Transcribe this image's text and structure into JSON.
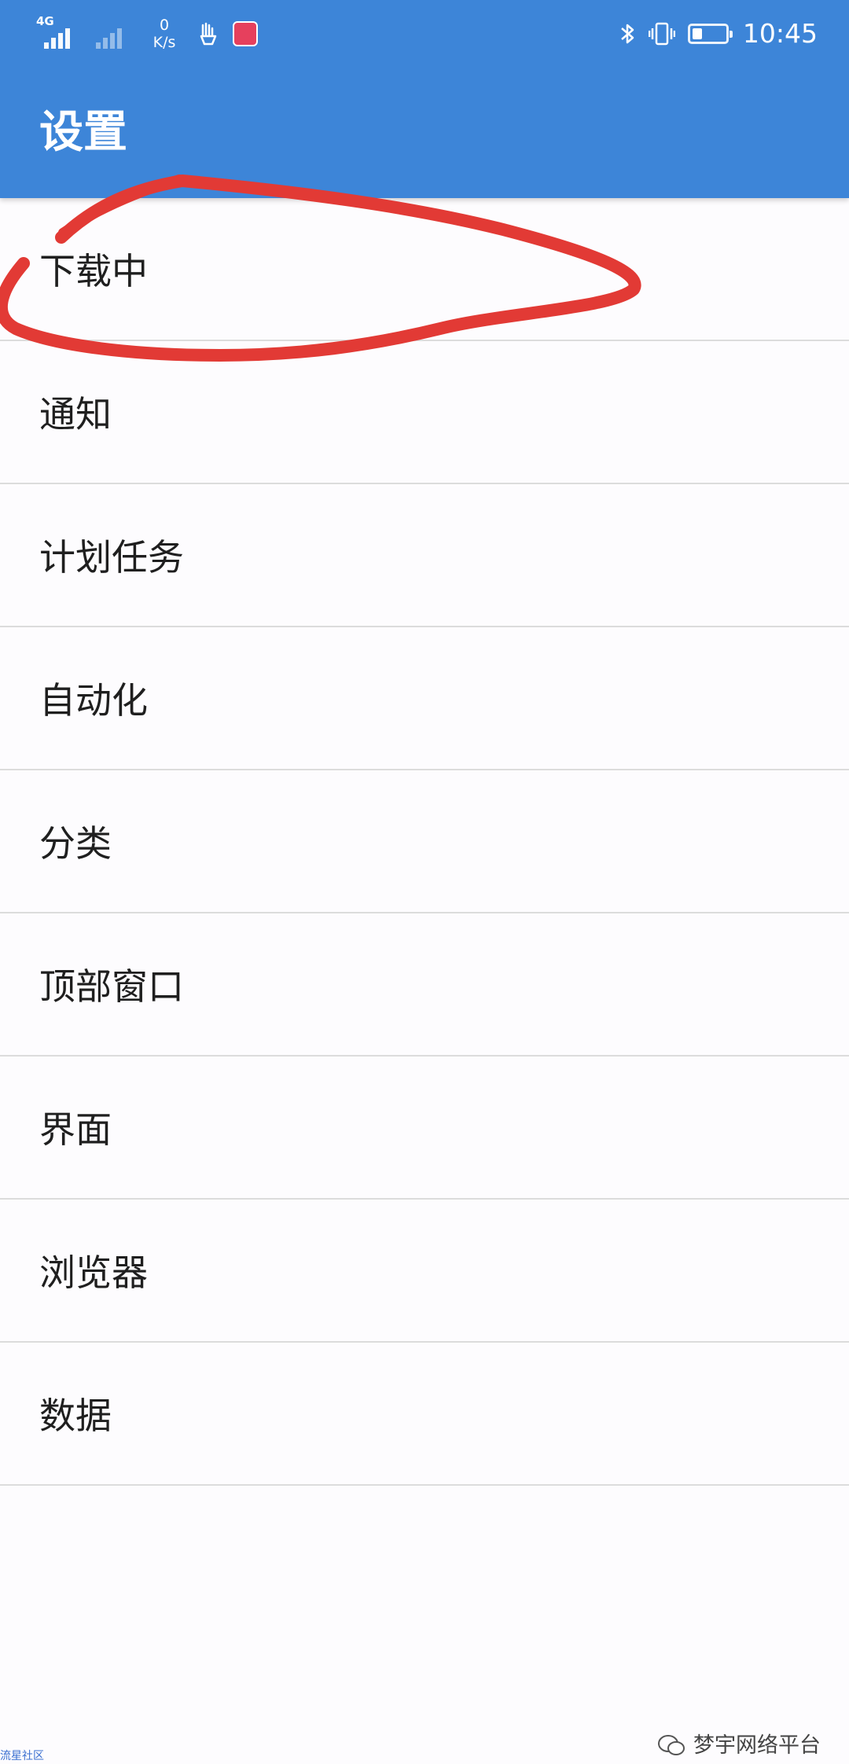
{
  "status_bar": {
    "network_type": "4G",
    "net_speed_value": "0",
    "net_speed_unit": "K/s",
    "time": "10:45",
    "battery_level_percent": 30
  },
  "app_bar": {
    "title": "设置"
  },
  "settings_items": [
    {
      "label": "下载中"
    },
    {
      "label": "通知"
    },
    {
      "label": "计划任务"
    },
    {
      "label": "自动化"
    },
    {
      "label": "分类"
    },
    {
      "label": "顶部窗口"
    },
    {
      "label": "界面"
    },
    {
      "label": "浏览器"
    },
    {
      "label": "数据"
    }
  ],
  "watermark": {
    "text": "梦宇网络平台"
  },
  "corner_mark": {
    "text": "流星社区"
  },
  "colors": {
    "app_bar": "#3d85d8",
    "annotation": "#e23a35",
    "background": "#fdfcfe",
    "divider": "#dcdcdc"
  }
}
